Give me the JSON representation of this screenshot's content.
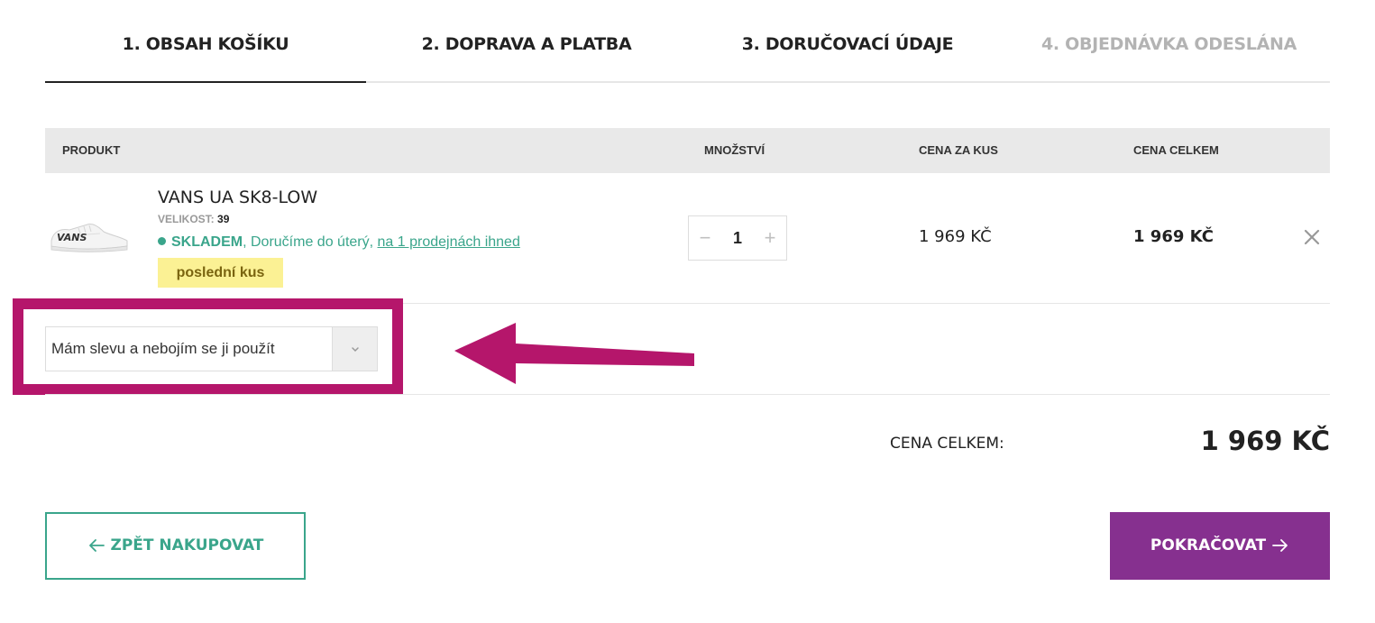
{
  "steps": [
    {
      "label": "1. OBSAH KOŠÍKU",
      "state": "active"
    },
    {
      "label": "2. DOPRAVA A PLATBA",
      "state": "default"
    },
    {
      "label": "3. DORUČOVACÍ ÚDAJE",
      "state": "default"
    },
    {
      "label": "4. OBJEDNÁVKA ODESLÁNA",
      "state": "disabled"
    }
  ],
  "table": {
    "headers": {
      "product": "PRODUKT",
      "quantity": "MNOŽSTVÍ",
      "unit_price": "CENA ZA KUS",
      "total": "CENA CELKEM"
    }
  },
  "item": {
    "image_icon": "sneaker-icon",
    "image_brand": "VANS",
    "name": "VANS UA SK8-LOW",
    "size_label": "VELIKOST:",
    "size_value": "39",
    "stock_status": "SKLADEM",
    "delivery_text": ", Doručíme do úterý, ",
    "store_link": "na 1 prodejnách ihned",
    "badge": "poslední kus",
    "quantity": "1",
    "minus": "−",
    "plus": "+",
    "unit_price": "1 969 KČ",
    "line_total": "1 969 KČ"
  },
  "discount": {
    "label": "Mám slevu a nebojím se ji použít"
  },
  "summary": {
    "label": "CENA CELKEM:",
    "value": "1 969 KČ"
  },
  "buttons": {
    "back": "ZPĚT NAKUPOVAT",
    "next": "POKRAČOVAT"
  },
  "colors": {
    "accent_green": "#3aa58b",
    "primary_purple": "#86308f",
    "highlight_magenta": "#b5166b",
    "badge_yellow": "#fbf194"
  }
}
